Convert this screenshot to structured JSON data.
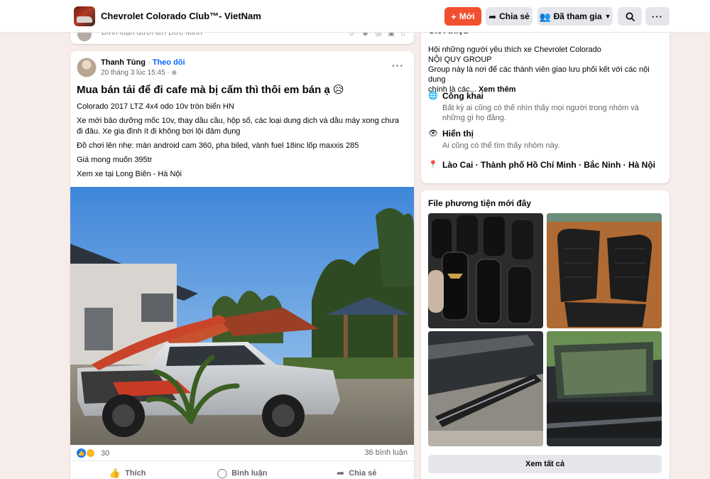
{
  "header": {
    "group_name": "Chevrolet Colorado Club™- VietNam",
    "new_label": "Mới",
    "share_label": "Chia sẻ",
    "joined_label": "Đã tham gia"
  },
  "previous_post": {
    "comment_placeholder": "Bình luận dưới tên Đức Minh"
  },
  "post": {
    "author": "Thanh Tùng",
    "separator": "·",
    "follow": "Theo dõi",
    "time": "20 tháng 3 lúc 15:45 ·",
    "title": "Mua bán tải để đi cafe mà bị cấm thì thôi em bán ạ 😥",
    "body": [
      "Colorado 2017 LTZ 4x4 odo 10v tròn biển HN",
      "Xe mới bảo dưỡng mốc 10v, thay dầu cầu, hộp số, các loại dung dịch và dầu máy xong chưa đi đâu. Xe gia đình ít đi không bơi lội đâm đụng",
      "Đồ chơi lên nhẹ: màn android cam 360, pha biled, vành fuel 18inc lốp maxxis 285",
      "Giá mong muốn 395tr",
      "Xem xe tại Long Biên - Hà Nội"
    ],
    "reaction_count": "30",
    "comments_count": "36 bình luận",
    "actions": {
      "like": "Thích",
      "comment": "Bình luận",
      "share": "Chia sẻ"
    }
  },
  "about": {
    "heading": "Giới thiệu",
    "description": "Hội những người yêu thích xe Chevrolet Colorado NỘI QUY GROUP Group này là nơi để các thành viên giao lưu phối kết với các nội dung chính là các...",
    "description_lines": [
      "Hội những người yêu thích xe Chevrolet Colorado",
      "NỘI QUY GROUP",
      "Group này là nơi để các thành viên giao lưu phối kết với các nội dung",
      "chính là các..."
    ],
    "see_more": "Xem thêm",
    "public_title": "Công khai",
    "public_desc": "Bất kỳ ai cũng có thể nhìn thấy mọi người trong nhóm và những gì họ đăng.",
    "visible_title": "Hiển thị",
    "visible_desc": "Ai cũng có thể tìm thấy nhóm này.",
    "locations": "Lào Cai · Thành phố Hồ Chí Minh · Bắc Ninh · Hà Nội"
  },
  "media": {
    "heading": "File phương tiện mới đây",
    "see_all": "Xem tất cả"
  },
  "icons": {
    "new": "plus-icon",
    "share": "share-arrow-icon",
    "joined": "group-icon",
    "search": "search-icon",
    "more": "more-icon",
    "public": "globe-icon",
    "visible": "eye-icon",
    "location": "location-pin-icon"
  },
  "colors": {
    "brand_orange": "#f0502e",
    "link_blue": "#0866ff",
    "button_gray": "#e4e6eb",
    "background": "#f6ecea"
  }
}
